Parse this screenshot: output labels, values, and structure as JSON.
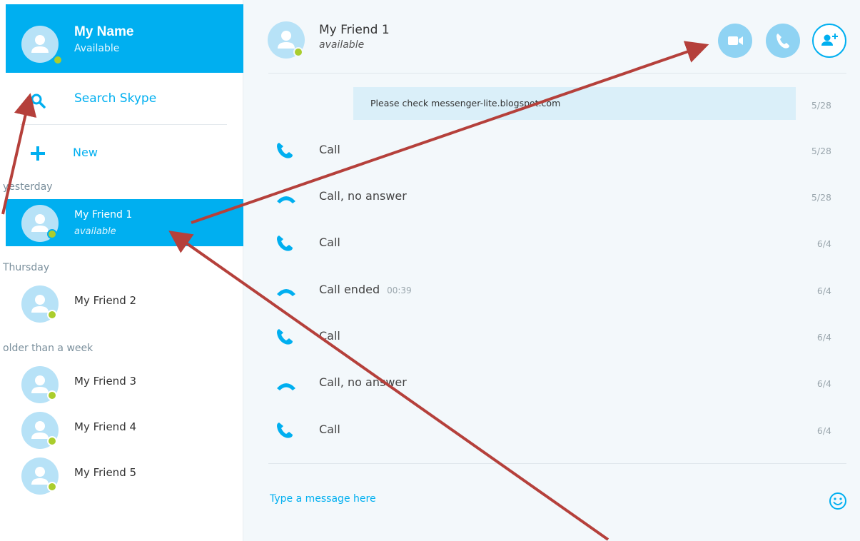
{
  "me": {
    "name": "My Name",
    "status": "Available"
  },
  "search": {
    "label": "Search Skype"
  },
  "new_item": {
    "label": "New"
  },
  "groups": {
    "yesterday": "yesterday",
    "thursday": "Thursday",
    "older": "older than a week"
  },
  "contacts": [
    {
      "name": "My Friend 1",
      "status": "available",
      "selected": true
    },
    {
      "name": "My Friend 2"
    },
    {
      "name": "My Friend 3"
    },
    {
      "name": "My Friend 4"
    },
    {
      "name": "My Friend 5"
    }
  ],
  "chat": {
    "name": "My Friend 1",
    "status": "available",
    "buttons": [
      "video-call-icon",
      "audio-call-icon",
      "add-participant-icon"
    ]
  },
  "messages": [
    {
      "type": "note",
      "text": "Please check messenger-lite.blogspot.com",
      "date": "5/28"
    },
    {
      "type": "call",
      "icon": "phone-icon",
      "text": "Call",
      "date": "5/28"
    },
    {
      "type": "call",
      "icon": "hangup-icon",
      "text": "Call, no answer",
      "date": "5/28"
    },
    {
      "type": "call",
      "icon": "phone-icon",
      "text": "Call",
      "date": "6/4"
    },
    {
      "type": "call",
      "icon": "hangup-icon",
      "text": "Call ended",
      "duration": "00:39",
      "date": "6/4"
    },
    {
      "type": "call",
      "icon": "phone-icon",
      "text": "Call",
      "date": "6/4"
    },
    {
      "type": "call",
      "icon": "hangup-icon",
      "text": "Call, no answer",
      "date": "6/4"
    },
    {
      "type": "call",
      "icon": "phone-icon",
      "text": "Call",
      "date": "6/4"
    }
  ],
  "composer": {
    "placeholder": "Type a message here"
  },
  "colors": {
    "accent": "#00aff0",
    "presence": "#aacd2d",
    "avatar_bg": "#b7e2f7",
    "note_bg": "#daeff9",
    "arrow": "#b5403b"
  }
}
